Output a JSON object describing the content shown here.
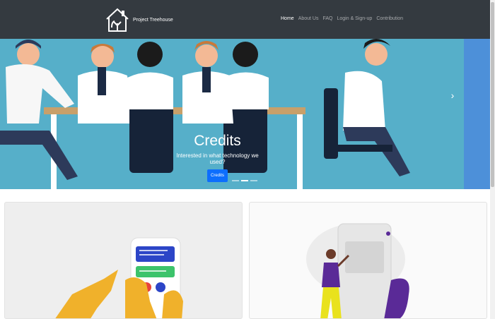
{
  "navbar": {
    "brand_name": "Project Treehouse",
    "links": [
      "Home",
      "About Us",
      "FAQ",
      "Login & Sign-up",
      "Contribution"
    ]
  },
  "carousel": {
    "title": "Credits",
    "subtitle": "Interested in what technology we used?",
    "button_label": "Credits",
    "next_icon": "chevron-right-icon",
    "slide_count": 3,
    "active_slide": 2
  },
  "colors": {
    "navbar_bg": "#343a40",
    "carousel_bg": "#56afc9",
    "button_bg": "#0d6efd",
    "accent_yellow": "#f0b12b",
    "accent_purple": "#5a2a97"
  }
}
